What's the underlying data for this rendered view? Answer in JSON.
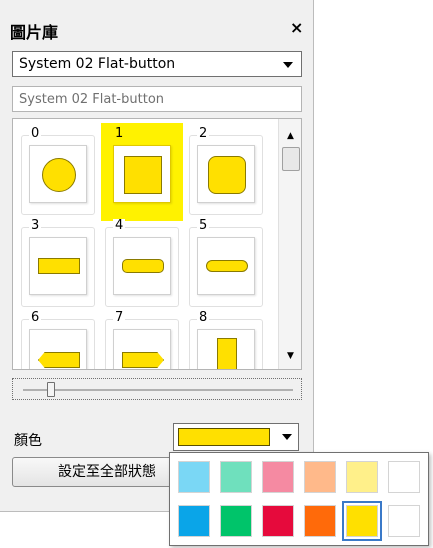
{
  "panel": {
    "title": "圖片庫",
    "close_label": "×",
    "library_dropdown": {
      "value": "System 02 Flat-button"
    },
    "name_field": {
      "value": "System 02 Flat-button"
    },
    "gallery_items": [
      {
        "label": "0",
        "shape": "circle"
      },
      {
        "label": "1",
        "shape": "square",
        "selected": true
      },
      {
        "label": "2",
        "shape": "rounded-square"
      },
      {
        "label": "3",
        "shape": "rectangle"
      },
      {
        "label": "4",
        "shape": "rounded-rectangle"
      },
      {
        "label": "5",
        "shape": "pill"
      },
      {
        "label": "6",
        "shape": "arrow-left"
      },
      {
        "label": "7",
        "shape": "arrow-right"
      },
      {
        "label": "8",
        "shape": "tall-rectangle"
      }
    ],
    "color_label": "顏色",
    "current_color": "#ffe000",
    "apply_button": "設定至全部狀態"
  },
  "color_popup": {
    "colors": [
      "#7ad7f5",
      "#6fe0bd",
      "#f58aa2",
      "#ffb98a",
      "#fff08a",
      "#ffffff",
      "#0aa5e8",
      "#00c46a",
      "#e60a3c",
      "#ff6a0a",
      "#ffe000",
      "#ffffff"
    ],
    "selected_index": 10
  }
}
